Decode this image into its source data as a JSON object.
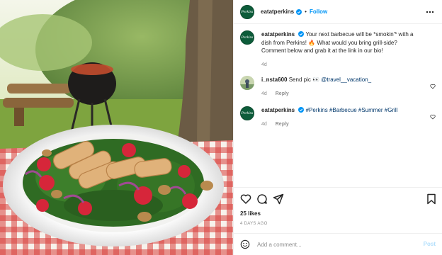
{
  "brand": {
    "avatar_text": "Perkins",
    "accent": "#0095f6",
    "avatar_color": "#0d5c3a"
  },
  "header": {
    "username": "eatatperkins",
    "separator": "•",
    "follow_label": "Follow",
    "more_icon": "more-horizontal-icon"
  },
  "caption": {
    "username": "eatatperkins",
    "text": "Your next barbecue will be *smokin'* with a dish from Perkins! 🔥 What would you bring grill-side? Comment below and grab it at the link in our bio!",
    "time": "4d"
  },
  "comments": [
    {
      "username": "i_nsta600",
      "text": "Send pic 👀",
      "mention": "@travel__vacation_",
      "time": "4d",
      "reply_label": "Reply"
    },
    {
      "username": "eatatperkins",
      "text": "",
      "mention": "#Perkins #Barbecue #Summer #Grill",
      "time": "4d",
      "reply_label": "Reply"
    }
  ],
  "actions": {
    "likes": "25 likes",
    "time_ago": "4 DAYS AGO"
  },
  "add_comment": {
    "placeholder": "Add a comment...",
    "post_label": "Post"
  }
}
